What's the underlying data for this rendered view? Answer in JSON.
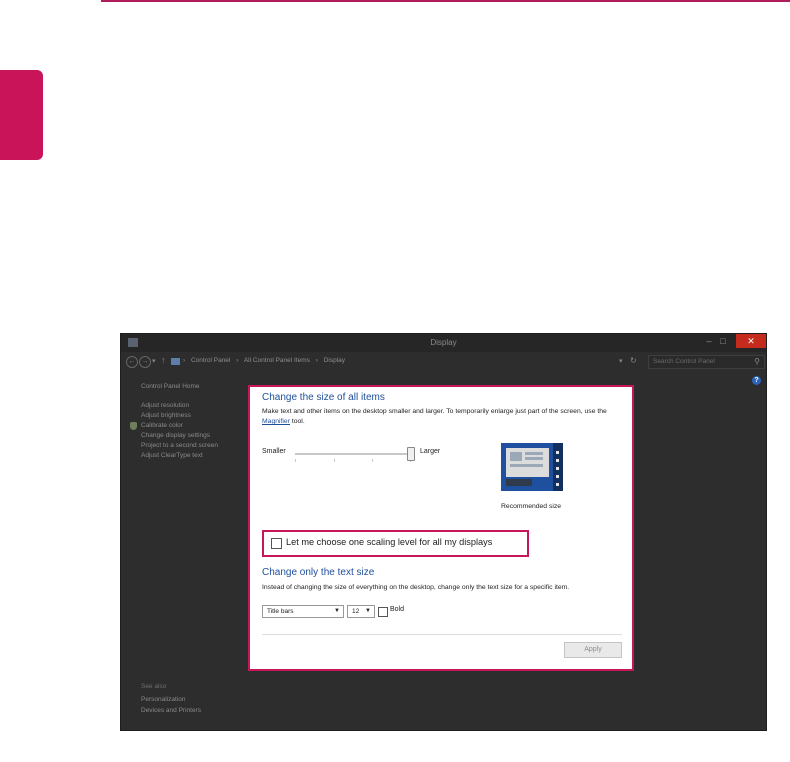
{
  "window": {
    "title": "Display"
  },
  "address": {
    "breadcrumbs": [
      "Control Panel",
      "›",
      "All Control Panel Items",
      "›",
      "Display"
    ],
    "search_placeholder": "Search Control Panel"
  },
  "sidebar": {
    "home": "Control Panel Home",
    "items": [
      {
        "label": "Adjust resolution"
      },
      {
        "label": "Adjust brightness"
      },
      {
        "label": "Calibrate color"
      },
      {
        "label": "Change display settings"
      },
      {
        "label": "Project to a second screen"
      },
      {
        "label": "Adjust ClearType text"
      }
    ],
    "see_also_title": "See also",
    "see_also": [
      {
        "label": "Personalization"
      },
      {
        "label": "Devices and Printers"
      }
    ]
  },
  "main": {
    "heading_all": "Change the size of all items",
    "description_part1": "Make text and other items on the desktop smaller and larger. To temporarily enlarge just part of the screen, use the ",
    "magnifier_link": "Magnifier",
    "description_part2": " tool.",
    "slider": {
      "min_label": "Smaller",
      "max_label": "Larger",
      "value_fraction": 1.0
    },
    "recommended_label": "Recommended size",
    "choose_scaling_label": "Let me choose one scaling level for all my displays",
    "choose_scaling_checked": false,
    "heading_text": "Change only the text size",
    "description_text": "Instead of changing the size of everything on the desktop, change only the text size for a specific item.",
    "item_select_value": "Title bars",
    "size_select_value": "12",
    "bold_label": "Bold",
    "bold_checked": false,
    "apply_label": "Apply"
  },
  "colors": {
    "accent": "#c5175a",
    "heading": "#1e4e9a",
    "close": "#c42b1c"
  }
}
